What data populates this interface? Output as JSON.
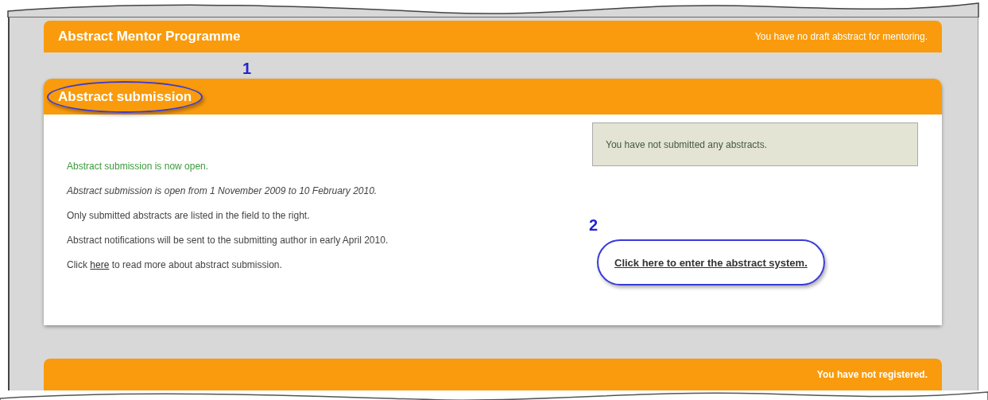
{
  "top_bar": {
    "title": "Abstract Mentor Programme",
    "note": "You have no draft abstract for mentoring."
  },
  "section": {
    "title": "Abstract submission",
    "annotation": "1",
    "paragraphs": [
      {
        "kind": "status",
        "text": "Abstract submission is now open."
      },
      {
        "kind": "italic",
        "text": "Abstract submission is open from 1 November 2009 to 10 February 2010."
      },
      {
        "kind": "plain",
        "text": "Only submitted abstracts are listed in the field to the right."
      },
      {
        "kind": "plain",
        "text": "Abstract notifications will be sent to the submitting author in early April 2010."
      },
      {
        "kind": "link",
        "before": "Click",
        "link": "here",
        "after": "to read more about abstract submission."
      }
    ],
    "submitted_box": "You have not submitted any abstracts.",
    "enter_annotation": "2",
    "enter_link": "Click here to enter the abstract system."
  },
  "bottom_bar": {
    "note": "You have not registered."
  }
}
